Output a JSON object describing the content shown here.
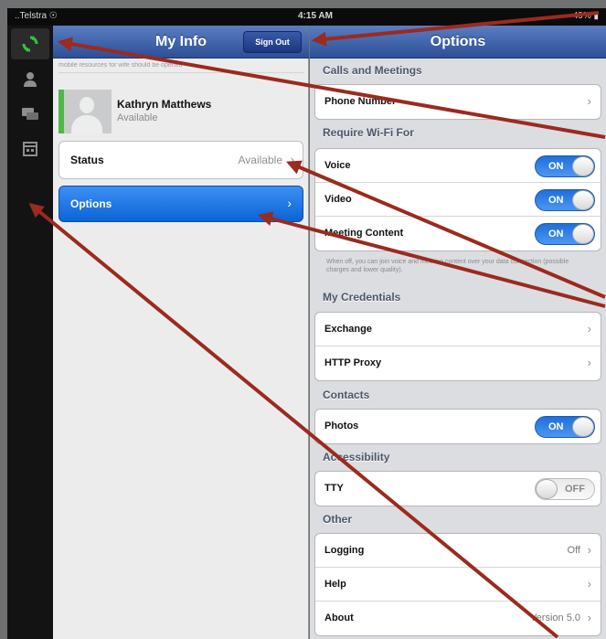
{
  "status_bar": {
    "carrier": "..Telstra ☉",
    "time": "4:15 AM",
    "battery": "49% ▮"
  },
  "rail": {
    "icons": [
      "sync-icon",
      "contacts-icon",
      "chat-icon",
      "calendar-icon"
    ],
    "active_color": "#37c43a"
  },
  "my_info": {
    "title": "My Info",
    "sign_out": "Sign Out",
    "banner": "mobile resources for wife should be opened"
  },
  "profile": {
    "name": "Kathryn Matthews",
    "presence": "Available",
    "presence_color": "#50b848"
  },
  "status_row": {
    "label": "Status",
    "value": "Available",
    "chevron": "›"
  },
  "options_row": {
    "label": "Options",
    "chevron": "›"
  },
  "options": {
    "title": "Options",
    "sections": [
      {
        "header": "Calls and Meetings",
        "rows": [
          {
            "label": "Phone Number",
            "control": "chevron"
          }
        ]
      },
      {
        "header": "Require Wi-Fi For",
        "rows": [
          {
            "label": "Voice",
            "control": "toggle",
            "toggle": "ON"
          },
          {
            "label": "Video",
            "control": "toggle",
            "toggle": "ON"
          },
          {
            "label": "Meeting Content",
            "control": "toggle",
            "toggle": "ON"
          }
        ],
        "note": "When off, you can join voice and meeting content over your data connection (possible charges and lower quality)."
      },
      {
        "header": "My Credentials",
        "rows": [
          {
            "label": "Exchange",
            "control": "chevron"
          },
          {
            "label": "HTTP Proxy",
            "control": "chevron"
          }
        ]
      },
      {
        "header": "Contacts",
        "rows": [
          {
            "label": "Photos",
            "control": "toggle",
            "toggle": "ON"
          }
        ]
      },
      {
        "header": "Accessibility",
        "rows": [
          {
            "label": "TTY",
            "control": "toggle",
            "toggle": "OFF"
          }
        ]
      },
      {
        "header": "Other",
        "rows": [
          {
            "label": "Logging",
            "control": "value",
            "value": "Off"
          },
          {
            "label": "Help",
            "control": "chevron"
          },
          {
            "label": "About",
            "control": "value",
            "value": "Version 5.0"
          }
        ]
      }
    ]
  },
  "colors": {
    "nav_bar": "#3b5fad",
    "toggle_on": "#2f7de6",
    "options_row": "#1d74e6",
    "arrow": "#9b2a1f"
  }
}
